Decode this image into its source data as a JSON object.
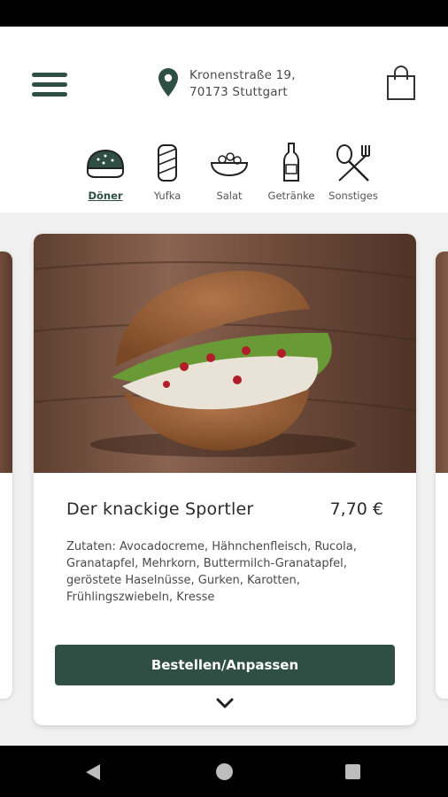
{
  "header": {
    "address_line1": "Kronenstraße 19,",
    "address_line2": "70173 Stuttgart",
    "menu_icon": "hamburger-menu-icon",
    "location_icon": "map-pin-icon",
    "cart_icon": "shopping-bag-icon"
  },
  "categories": [
    {
      "label": "Döner",
      "icon": "doner-bread-icon",
      "active": true
    },
    {
      "label": "Yufka",
      "icon": "wrap-icon",
      "active": false
    },
    {
      "label": "Salat",
      "icon": "salad-bowl-icon",
      "active": false
    },
    {
      "label": "Getränke",
      "icon": "bottle-icon",
      "active": false
    },
    {
      "label": "Sonstiges",
      "icon": "fork-knife-icon",
      "active": false
    }
  ],
  "product": {
    "name": "Der knackige Sportler",
    "price": "7,70 €",
    "description": "Zutaten: Avocadocreme, Hähnchenfleisch, Rucola, Granatapfel, Mehrkorn, Buttermilch-Granatapfel, geröstete Haselnüsse, Gurken, Karotten, Frühlingszwiebeln, Kresse",
    "order_label": "Bestellen/Anpassen"
  },
  "colors": {
    "accent": "#2f4f45",
    "background": "#f0f0f0"
  }
}
